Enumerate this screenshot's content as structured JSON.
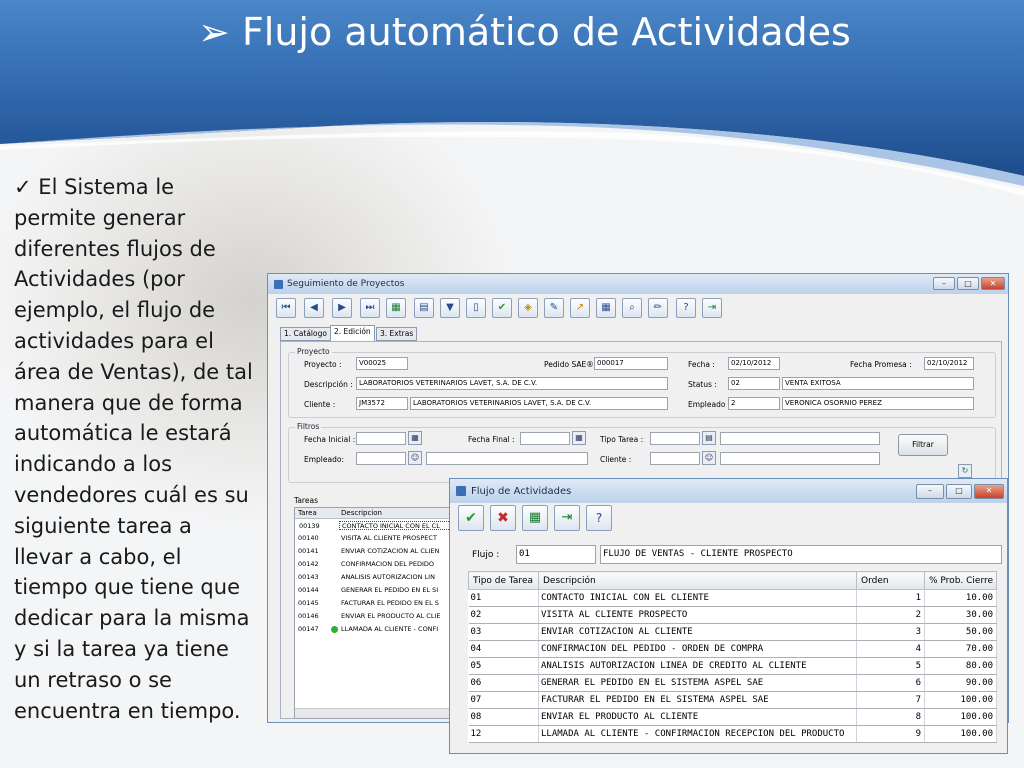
{
  "slide": {
    "title": "Flujo automático de Actividades",
    "title_glyph": "➢",
    "check_glyph": "✓",
    "bullet": "El Sistema le permite generar diferentes flujos de Actividades (por ejemplo, el flujo de actividades para el área de Ventas), de tal manera que de forma automática le estará indicando a los vendedores cuál es su siguiente tarea a llevar a cabo, el tiempo que tiene que dedicar para la misma y si la tarea ya tiene un retraso o se encuentra en tiempo."
  },
  "win1": {
    "title": "Seguimiento de Proyectos",
    "tabs": [
      "1. Catálogo",
      "2. Edición",
      "3. Extras"
    ],
    "proyecto": {
      "group": "Proyecto",
      "proyecto_label": "Proyecto :",
      "proyecto_value": "V00025",
      "pedido_label": "Pedido SAE® :",
      "pedido_value": "000017",
      "fecha_label": "Fecha :",
      "fecha_value": "02/10/2012",
      "promesa_label": "Fecha Promesa :",
      "promesa_value": "02/10/2012",
      "descripcion_label": "Descripción :",
      "descripcion_value": "LABORATORIOS VETERINARIOS LAVET, S.A. DE C.V.",
      "status_label": "Status :",
      "status_code": "02",
      "status_value": "VENTA EXITOSA",
      "cliente_label": "Cliente :",
      "cliente_code": "JM3572",
      "cliente_value": "LABORATORIOS VETERINARIOS LAVET, S.A. DE C.V.",
      "empleado_label": "Empleado :",
      "empleado_code": "2",
      "empleado_value": "VERONICA OSORNIO PEREZ"
    },
    "filtros": {
      "group": "Filtros",
      "fecha_inicial_label": "Fecha Inicial :",
      "fecha_final_label": "Fecha Final :",
      "tipo_tarea_label": "Tipo Tarea :",
      "empleado_label": "Empleado:",
      "cliente_label": "Cliente :",
      "filtrar": "Filtrar"
    },
    "tareas": {
      "group": "Tareas",
      "col_tarea": "Tarea",
      "col_descripcion": "Descripcion",
      "rows": [
        {
          "tarea": "00139",
          "desc": "CONTACTO INICIAL CON EL CL"
        },
        {
          "tarea": "00140",
          "desc": "VISITA AL CLIENTE PROSPECT"
        },
        {
          "tarea": "00141",
          "desc": "ENVIAR COTIZACION AL CLIEN"
        },
        {
          "tarea": "00142",
          "desc": "CONFIRMACION DEL PEDIDO"
        },
        {
          "tarea": "00143",
          "desc": "ANALISIS AUTORIZACION LIN"
        },
        {
          "tarea": "00144",
          "desc": "GENERAR EL PEDIDO EN EL SI"
        },
        {
          "tarea": "00145",
          "desc": "FACTURAR EL PEDIDO EN EL S"
        },
        {
          "tarea": "00146",
          "desc": "ENVIAR EL PRODUCTO AL CLIE"
        },
        {
          "tarea": "00147",
          "desc": "LLAMADA AL CLIENTE - CONFI"
        }
      ]
    }
  },
  "win2": {
    "title": "Flujo de Actividades",
    "flujo_label": "Flujo :",
    "flujo_code": "01",
    "flujo_name": "FLUJO DE VENTAS - CLIENTE PROSPECTO",
    "columns": [
      "Tipo de Tarea",
      "Descripción",
      "Orden",
      "% Prob. Cierre"
    ],
    "rows": [
      {
        "tipo": "01",
        "desc": "CONTACTO INICIAL CON EL CLIENTE",
        "orden": "1",
        "prob": "10.00"
      },
      {
        "tipo": "02",
        "desc": "VISITA AL CLIENTE PROSPECTO",
        "orden": "2",
        "prob": "30.00"
      },
      {
        "tipo": "03",
        "desc": "ENVIAR COTIZACION AL CLIENTE",
        "orden": "3",
        "prob": "50.00"
      },
      {
        "tipo": "04",
        "desc": "CONFIRMACION DEL PEDIDO - ORDEN DE COMPRA",
        "orden": "4",
        "prob": "70.00"
      },
      {
        "tipo": "05",
        "desc": "ANALISIS AUTORIZACION LINEA DE CREDITO AL CLIENTE",
        "orden": "5",
        "prob": "80.00"
      },
      {
        "tipo": "06",
        "desc": "GENERAR EL PEDIDO EN EL SISTEMA ASPEL SAE",
        "orden": "6",
        "prob": "90.00"
      },
      {
        "tipo": "07",
        "desc": "FACTURAR EL PEDIDO EN EL SISTEMA ASPEL SAE",
        "orden": "7",
        "prob": "100.00"
      },
      {
        "tipo": "08",
        "desc": "ENVIAR EL PRODUCTO AL CLIENTE",
        "orden": "8",
        "prob": "100.00"
      },
      {
        "tipo": "12",
        "desc": "LLAMADA AL CLIENTE - CONFIRMACION RECEPCION DEL PRODUCTO",
        "orden": "9",
        "prob": "100.00"
      }
    ]
  },
  "colors": {
    "banner_dark": "#1f4f8f",
    "banner_mid": "#3f7fc4",
    "win_border": "#6a8fb8"
  }
}
